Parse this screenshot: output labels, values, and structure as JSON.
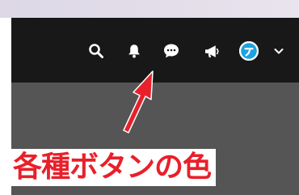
{
  "header": {
    "icons": [
      {
        "name": "search-icon"
      },
      {
        "name": "bell-icon"
      },
      {
        "name": "chat-bubble-icon"
      },
      {
        "name": "megaphone-icon"
      },
      {
        "name": "avatar"
      },
      {
        "name": "chevron-down-icon"
      }
    ]
  },
  "annotation": {
    "caption": "各種ボタンの色",
    "arrow_color": "#e8202a"
  },
  "colors": {
    "header_bg": "#181818",
    "content_bg": "#555555",
    "icon": "#ffffff",
    "avatar_accent": "#1aa3e0",
    "annotation": "#e8202a"
  }
}
